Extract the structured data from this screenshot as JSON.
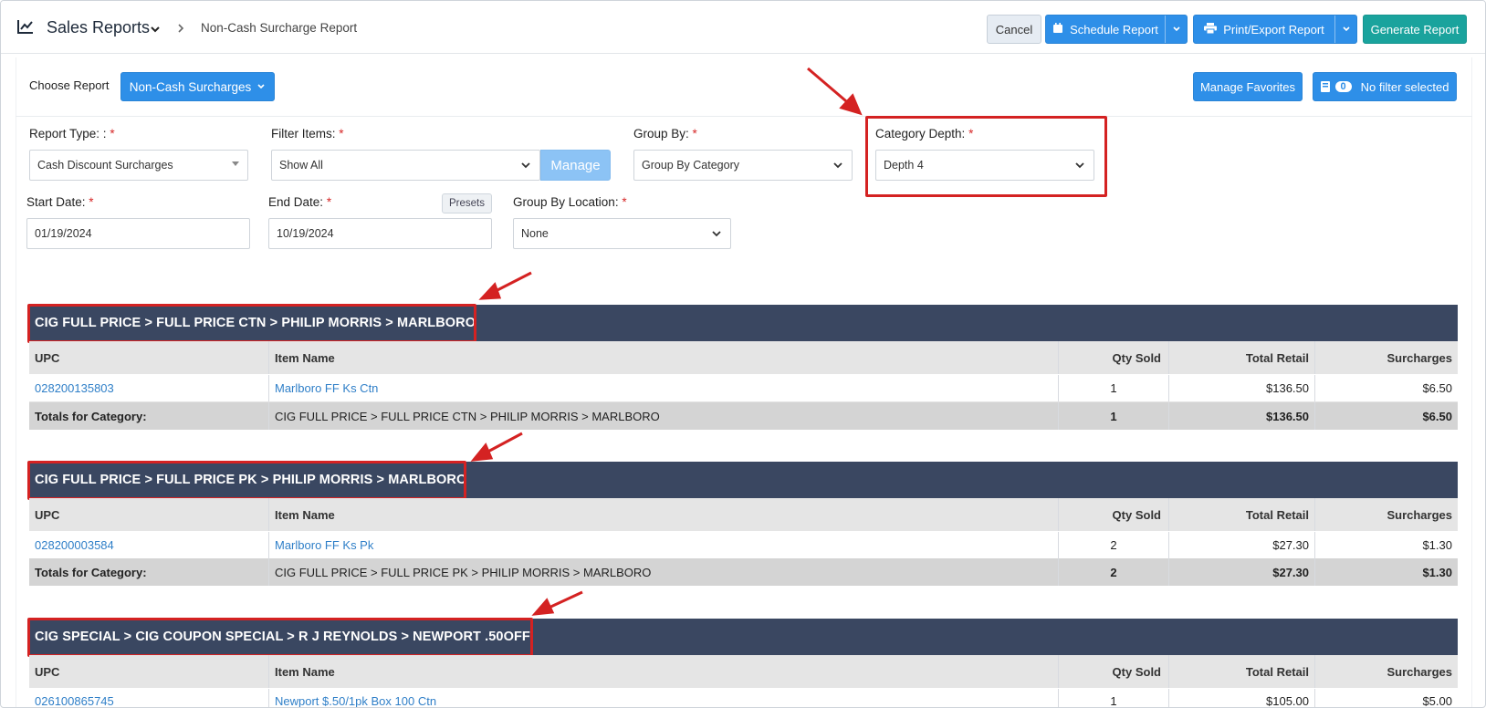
{
  "header": {
    "app_title": "Sales Reports",
    "breadcrumb": "Non-Cash Surcharge Report",
    "cancel_label": "Cancel",
    "schedule_label": "Schedule Report",
    "print_label": "Print/Export Report",
    "generate_label": "Generate Report"
  },
  "toolbar": {
    "choose_report_label": "Choose Report",
    "choose_report_value": "Non-Cash Surcharges",
    "manage_favorites_label": "Manage Favorites",
    "filter_count": "0",
    "filter_label": "No filter selected"
  },
  "form": {
    "report_type_label": "Report Type: :",
    "report_type_value": "Cash Discount Surcharges",
    "filter_items_label": "Filter Items:",
    "filter_items_value": "Show All",
    "manage_label": "Manage",
    "group_by_label": "Group By:",
    "group_by_value": "Group By Category",
    "category_depth_label": "Category Depth:",
    "category_depth_value": "Depth 4",
    "start_date_label": "Start Date:",
    "start_date_value": "01/19/2024",
    "end_date_label": "End Date:",
    "end_date_value": "10/19/2024",
    "presets_label": "Presets",
    "group_by_location_label": "Group By Location:",
    "group_by_location_value": "None",
    "required_mark": "*"
  },
  "table_headers": {
    "upc": "UPC",
    "item_name": "Item Name",
    "qty_sold": "Qty Sold",
    "total_retail": "Total Retail",
    "surcharges": "Surcharges"
  },
  "totals_label": "Totals for Category:",
  "categories": [
    {
      "title": "CIG FULL PRICE > FULL PRICE CTN > PHILIP MORRIS > MARLBORO",
      "item": {
        "upc": "028200135803",
        "name": "Marlboro FF Ks Ctn",
        "qty": "1",
        "retail": "$136.50",
        "surcharge": "$6.50"
      },
      "totals": {
        "name": "CIG FULL PRICE > FULL PRICE CTN > PHILIP MORRIS > MARLBORO",
        "qty": "1",
        "retail": "$136.50",
        "surcharge": "$6.50"
      }
    },
    {
      "title": "CIG FULL PRICE > FULL PRICE PK > PHILIP MORRIS > MARLBORO",
      "item": {
        "upc": "028200003584",
        "name": "Marlboro FF Ks Pk",
        "qty": "2",
        "retail": "$27.30",
        "surcharge": "$1.30"
      },
      "totals": {
        "name": "CIG FULL PRICE > FULL PRICE PK > PHILIP MORRIS > MARLBORO",
        "qty": "2",
        "retail": "$27.30",
        "surcharge": "$1.30"
      }
    },
    {
      "title": "CIG SPECIAL > CIG COUPON SPECIAL > R J REYNOLDS > NEWPORT .50OFF",
      "item": {
        "upc": "026100865745",
        "name": "Newport $.50/1pk Box 100 Ctn",
        "qty": "1",
        "retail": "$105.00",
        "surcharge": "$5.00"
      }
    }
  ],
  "colors": {
    "primary_blue": "#2e8fe8",
    "teal": "#1aa39d",
    "band": "#3a4761",
    "highlight_red": "#d42222"
  },
  "icons": [
    "chart-line-icon",
    "chevron-down-icon",
    "chevron-right-icon",
    "calendar-icon",
    "printer-icon",
    "filter-icon"
  ]
}
